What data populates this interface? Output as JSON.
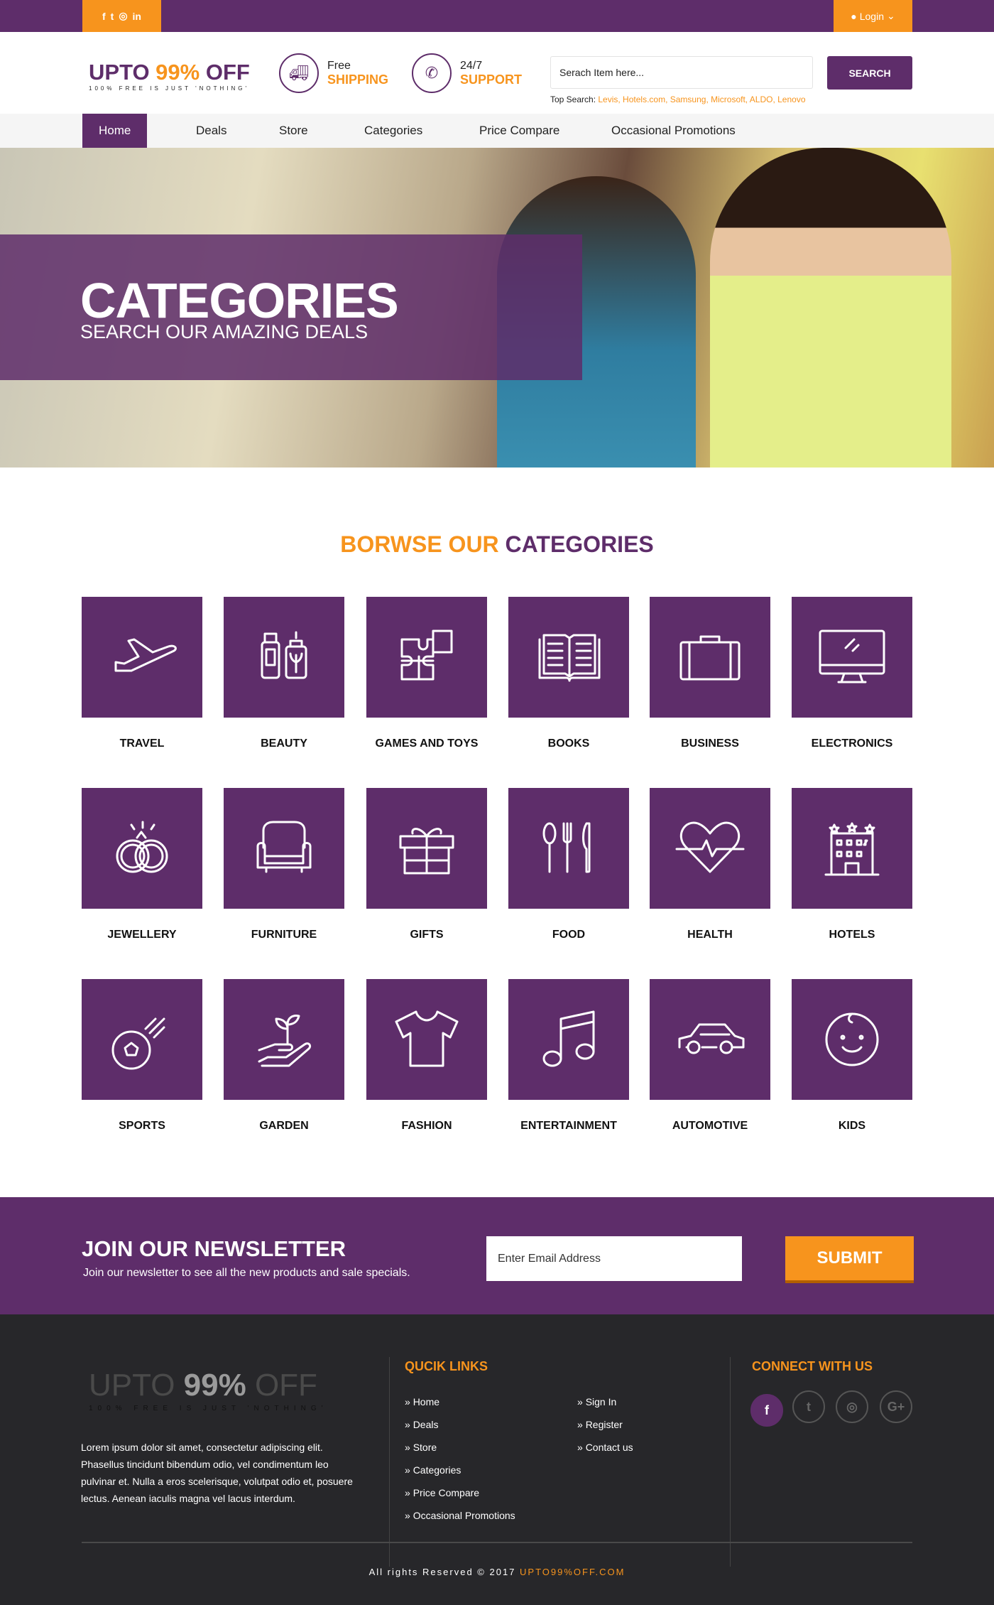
{
  "topbar": {
    "social_icons": [
      "facebook-icon",
      "twitter-icon",
      "instagram-icon",
      "linkedin-icon"
    ],
    "login_label": "Login"
  },
  "header": {
    "logo_prefix": "UPTO ",
    "logo_highlight": "99%",
    "logo_suffix": " OFF",
    "logo_tagline": "100% FREE IS JUST 'NOTHING'",
    "shipping_line1": "Free",
    "shipping_line2": "SHIPPING",
    "support_line1": "24/7",
    "support_line2": "SUPPORT",
    "search_placeholder": "Serach Item here...",
    "search_button": "SEARCH",
    "top_search_label": "Top Search: ",
    "top_search_links": "Levis, Hotels.com, Samsung, Microsoft, ALDO, Lenovo"
  },
  "nav": {
    "items": [
      "Home",
      "Deals",
      "Store",
      "Categories",
      "Price Compare",
      "Occasional Promotions"
    ],
    "active": "Home"
  },
  "hero": {
    "title": "CATEGORIES",
    "subtitle": "SEARCH OUR AMAZING DEALS"
  },
  "categories": {
    "title_part1": "BORWSE OUR ",
    "title_part2": "CATEGORIES",
    "items": [
      {
        "label": "TRAVEL",
        "icon": "airplane-icon"
      },
      {
        "label": "BEAUTY",
        "icon": "cosmetics-icon"
      },
      {
        "label": "GAMES AND TOYS",
        "icon": "puzzle-icon"
      },
      {
        "label": "BOOKS",
        "icon": "book-icon"
      },
      {
        "label": "BUSINESS",
        "icon": "briefcase-icon"
      },
      {
        "label": "ELECTRONICS",
        "icon": "monitor-icon"
      },
      {
        "label": "JEWELLERY",
        "icon": "rings-icon"
      },
      {
        "label": "FURNITURE",
        "icon": "armchair-icon"
      },
      {
        "label": "GIFTS",
        "icon": "gift-icon"
      },
      {
        "label": "FOOD",
        "icon": "cutlery-icon"
      },
      {
        "label": "HEALTH",
        "icon": "heartbeat-icon"
      },
      {
        "label": "HOTELS",
        "icon": "hotel-icon"
      },
      {
        "label": "SPORTS",
        "icon": "soccer-ball-icon"
      },
      {
        "label": "GARDEN",
        "icon": "plant-hand-icon"
      },
      {
        "label": "FASHION",
        "icon": "tshirt-icon"
      },
      {
        "label": "ENTERTAINMENT",
        "icon": "music-note-icon"
      },
      {
        "label": "AUTOMOTIVE",
        "icon": "car-icon"
      },
      {
        "label": "KIDS",
        "icon": "baby-face-icon"
      }
    ]
  },
  "newsletter": {
    "title": "JOIN OUR NEWSLETTER",
    "text": "Join our newsletter to see all the new products and sale specials.",
    "email_placeholder": "Enter Email Address",
    "submit": "SUBMIT"
  },
  "footer": {
    "logo_prefix": "UPTO ",
    "logo_highlight": "99%",
    "logo_suffix": " OFF",
    "logo_tagline": "100% FREE IS JUST 'NOTHING'",
    "description": "Lorem ipsum dolor sit amet, consectetur adipiscing elit. Phasellus tincidunt bibendum odio, vel condimentum leo pulvinar et. Nulla a eros scelerisque, volutpat odio et, posuere lectus. Aenean iaculis magna vel lacus interdum.",
    "quick_links_title": "QUCIK LINKS",
    "links_col1": [
      "Home",
      "Deals",
      "Store",
      "Categories",
      "Price Compare",
      "Occasional Promotions"
    ],
    "links_col2": [
      "Sign In",
      "Register",
      "Contact us"
    ],
    "connect_title": "CONNECT WITH US",
    "social": [
      "facebook-icon",
      "twitter-icon",
      "instagram-icon",
      "google-plus-icon"
    ],
    "copyright": "All rights Reserved © 2017 ",
    "copyright_brand": "UPTO99%OFF.COM"
  },
  "colors": {
    "purple": "#5e2d6a",
    "orange": "#f7941d",
    "footer_bg": "#27272a"
  }
}
